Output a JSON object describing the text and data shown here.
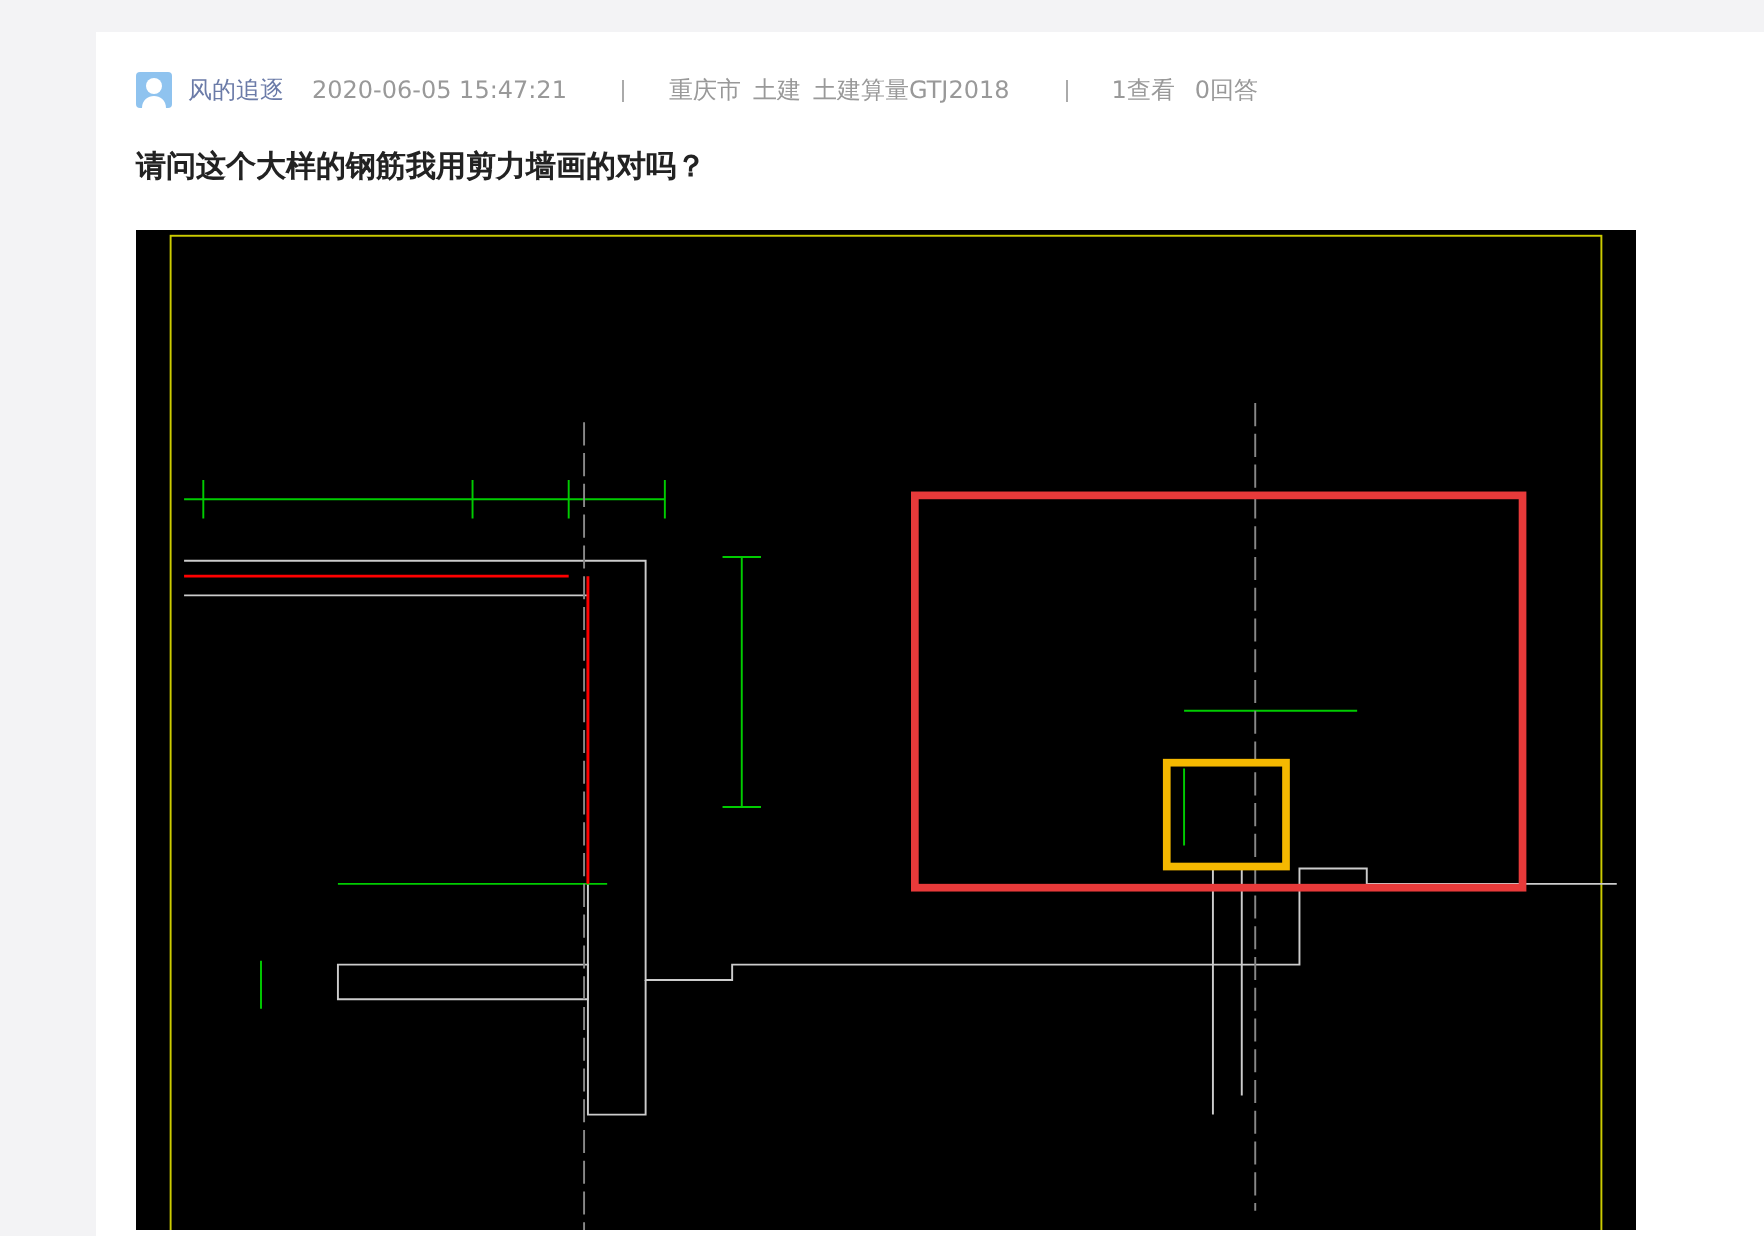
{
  "post": {
    "author": "风的追逐",
    "time": "2020-06-05 15:47:21",
    "meta": [
      {
        "kind": "region",
        "parts": [
          "重庆市",
          "土建",
          "土建算量GTJ2018"
        ]
      },
      {
        "kind": "stats",
        "parts": [
          "1查看",
          "0回答"
        ]
      }
    ],
    "title": "请问这个大样的钢筋我用剪力墙画的对吗？"
  }
}
